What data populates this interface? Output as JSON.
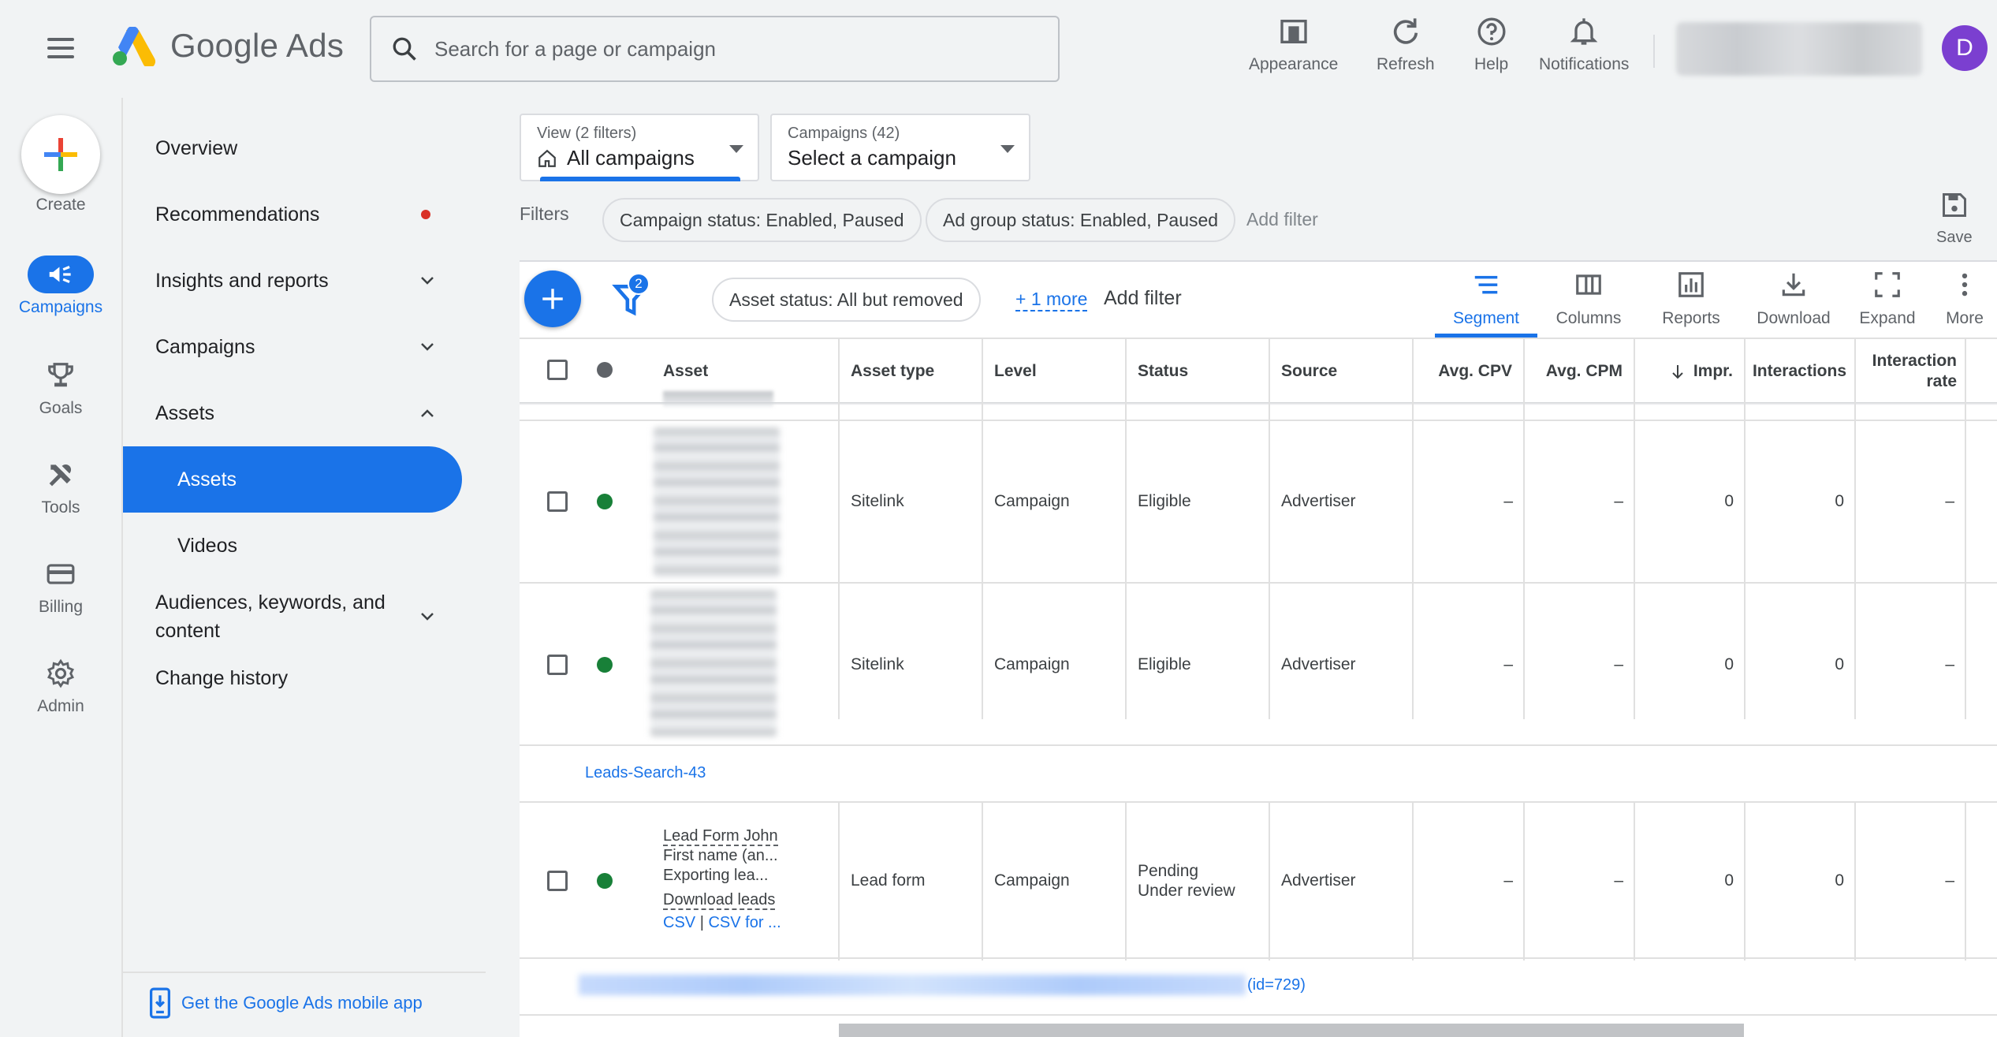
{
  "header": {
    "brand": "Google Ads",
    "search_placeholder": "Search for a page or campaign",
    "buttons": {
      "appearance": "Appearance",
      "refresh": "Refresh",
      "help": "Help",
      "notifications": "Notifications"
    },
    "avatar_initial": "D"
  },
  "rail": {
    "create": "Create",
    "campaigns": "Campaigns",
    "goals": "Goals",
    "tools": "Tools",
    "billing": "Billing",
    "admin": "Admin"
  },
  "nav": {
    "overview": "Overview",
    "recommendations": "Recommendations",
    "insights": "Insights and reports",
    "campaigns": "Campaigns",
    "assets": "Assets",
    "assets_sub": "Assets",
    "videos": "Videos",
    "audiences": "Audiences, keywords, and content",
    "change_history": "Change history",
    "mobile_app": "Get the Google Ads mobile app"
  },
  "view_dropdown": {
    "small": "View (2 filters)",
    "value": "All campaigns"
  },
  "campaign_dropdown": {
    "small": "Campaigns (42)",
    "value": "Select a campaign"
  },
  "filters": {
    "label": "Filters",
    "chips": [
      "Campaign status: Enabled, Paused",
      "Ad group status: Enabled, Paused"
    ],
    "add": "Add filter",
    "save": "Save"
  },
  "toolbar": {
    "filter_count": "2",
    "asset_status_chip": "Asset status: All but removed",
    "more_filters": "+ 1 more",
    "add_filter": "Add filter",
    "segment": "Segment",
    "columns": "Columns",
    "reports": "Reports",
    "download": "Download",
    "expand": "Expand",
    "more": "More"
  },
  "table": {
    "columns": [
      "Asset",
      "Asset type",
      "Level",
      "Status",
      "Source",
      "Avg. CPV",
      "Avg. CPM",
      "Impr.",
      "Interactions",
      "Interaction rate"
    ],
    "rows": [
      {
        "type": "Sitelink",
        "level": "Campaign",
        "status": "Eligible",
        "source": "Advertiser",
        "cpv": "–",
        "cpm": "–",
        "impr": "0",
        "interactions": "0",
        "rate": "–"
      },
      {
        "type": "Sitelink",
        "level": "Campaign",
        "status": "Eligible",
        "source": "Advertiser",
        "cpv": "–",
        "cpm": "–",
        "impr": "0",
        "interactions": "0",
        "rate": "–"
      }
    ],
    "group_label": "Leads-Search-43",
    "lead_row": {
      "asset_line1": "Lead Form John",
      "asset_line2": "First name (an...",
      "asset_line3": "Exporting lea...",
      "asset_line4": "Download leads",
      "csv": "CSV",
      "csv_sep": "|",
      "csv_for": "CSV for ...",
      "type": "Lead form",
      "level": "Campaign",
      "status_line1": "Pending",
      "status_line2": "Under review",
      "source": "Advertiser",
      "cpv": "–",
      "cpm": "–",
      "impr": "0",
      "interactions": "0",
      "rate": "–"
    },
    "footer_id": "(id=729)"
  }
}
